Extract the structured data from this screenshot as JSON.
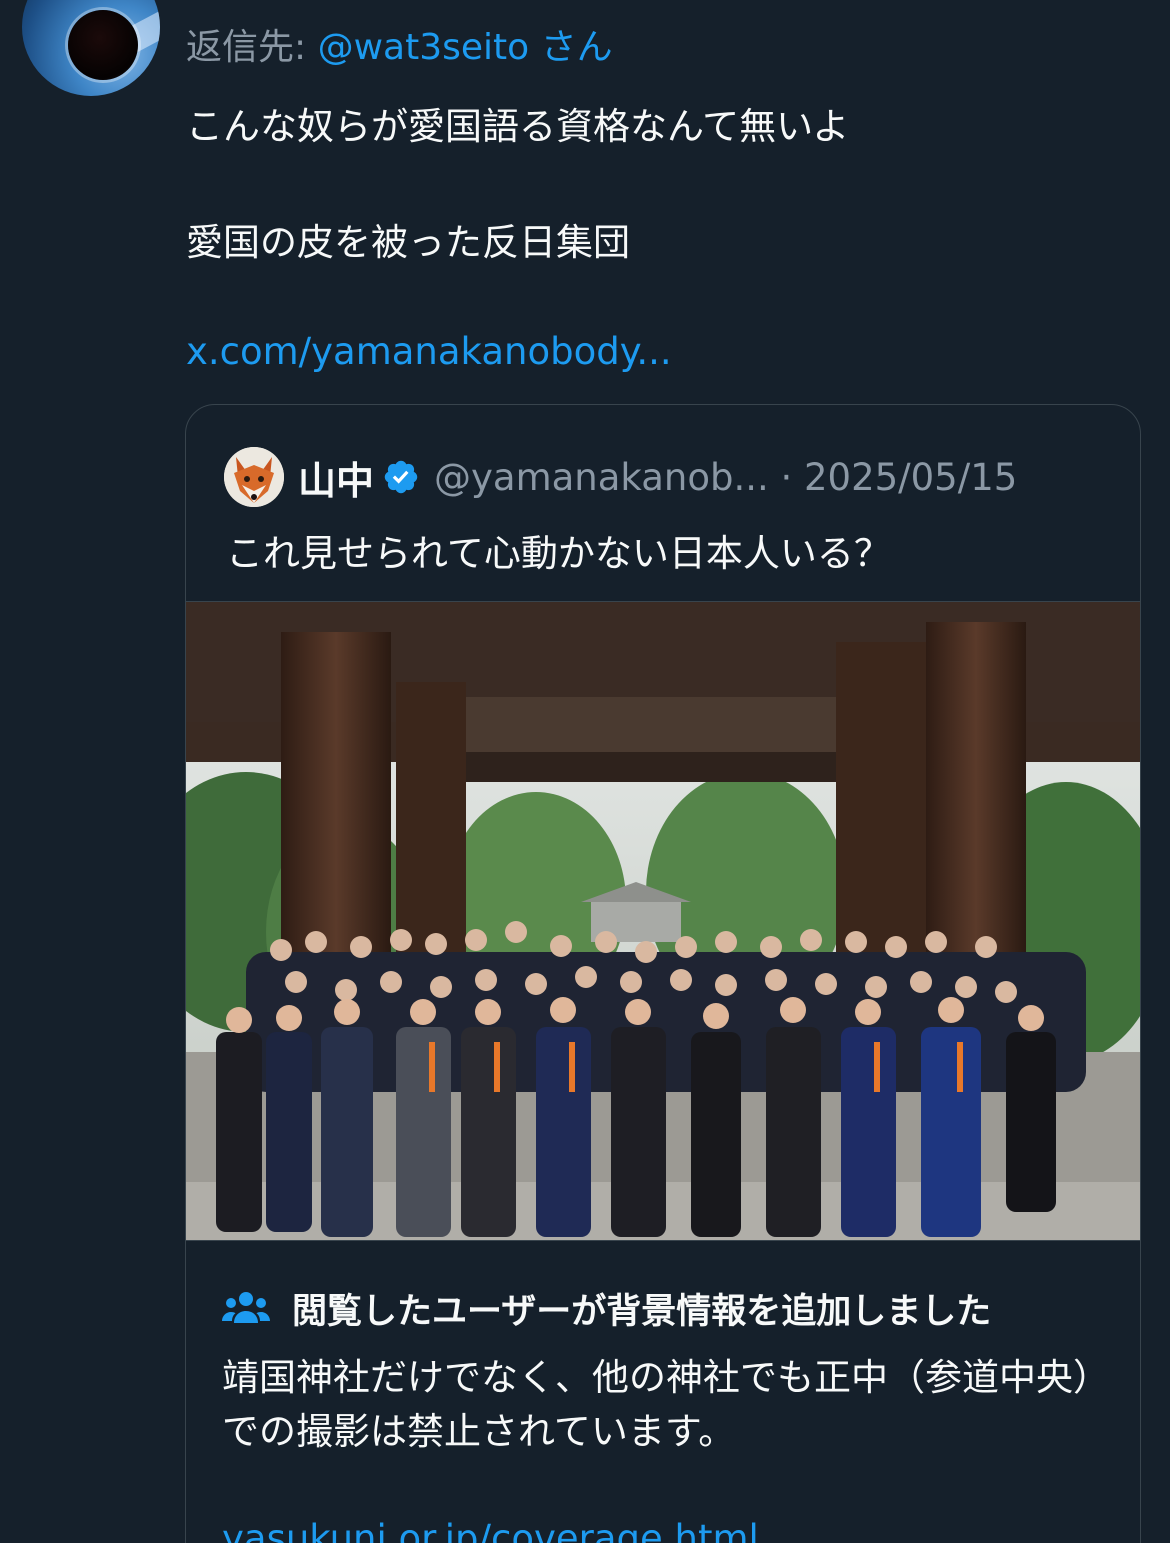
{
  "reply": {
    "prefix": "返信先: ",
    "handle": "@wat3seito",
    "suffix": " さん"
  },
  "tweet": {
    "line1": "こんな奴らが愛国語る資格なんて無いよ",
    "line2": "愛国の皮を被った反日集団",
    "link": "x.com/yamanakanobody..."
  },
  "quote": {
    "name": "山中",
    "handle_date": "@yamanakanob... · 2025/05/15",
    "text": "これ見せられて心動かない日本人いる？",
    "avatar_icon": "fox-avatar",
    "verified_icon": "verified-badge-icon"
  },
  "community_note": {
    "icon": "users-icon",
    "title": "閲覧したユーザーが背景情報を追加しました",
    "body": "靖国神社だけでなく、他の神社でも正中（参道中央）での撮影は禁止されています。",
    "link": "yasukuni.or.jp/coverage.html"
  },
  "colors": {
    "background": "#15202b",
    "accent": "#1d9bf0",
    "secondary_text": "#8b98a5",
    "border": "#38444d"
  }
}
